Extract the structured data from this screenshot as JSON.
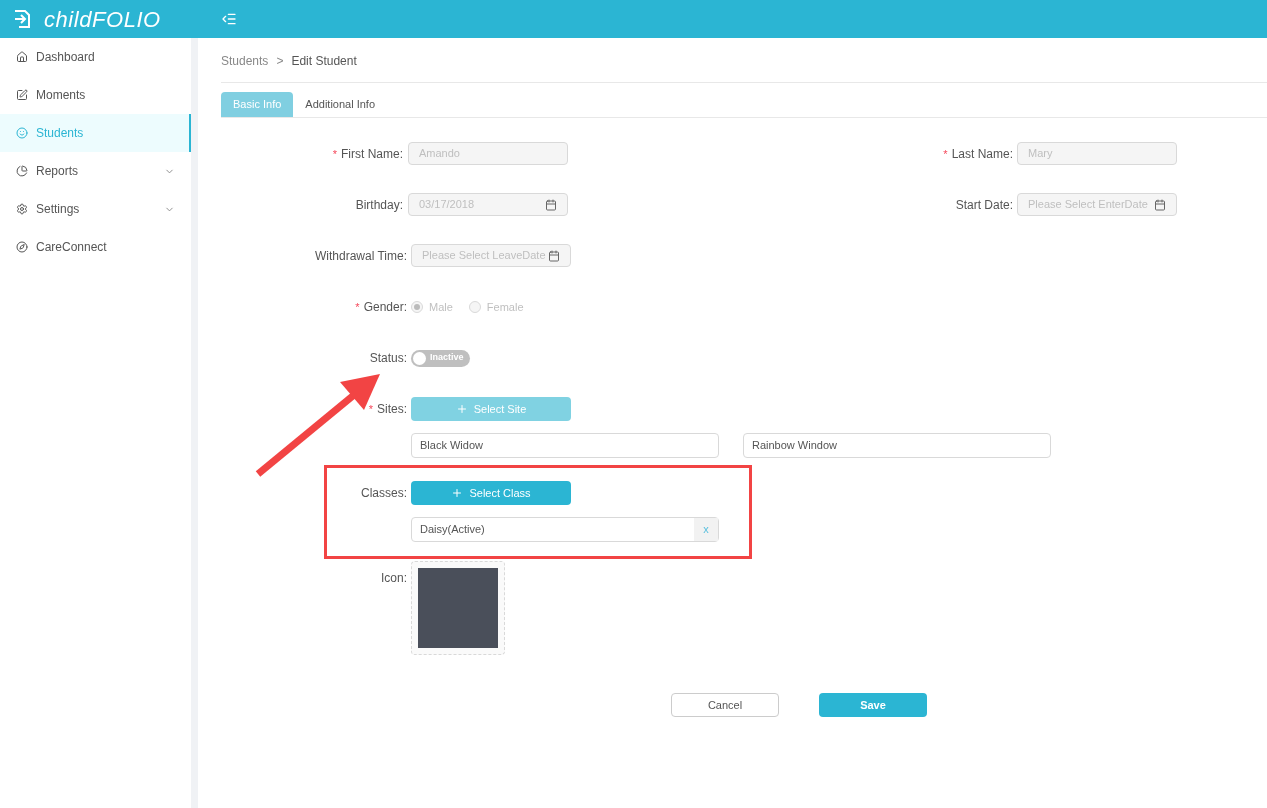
{
  "header": {
    "logo": "childFOLIO"
  },
  "sidebar": {
    "items": [
      {
        "label": "Dashboard",
        "selected": false,
        "has_submenu": false
      },
      {
        "label": "Moments",
        "selected": false,
        "has_submenu": false
      },
      {
        "label": "Students",
        "selected": true,
        "has_submenu": false
      },
      {
        "label": "Reports",
        "selected": false,
        "has_submenu": true
      },
      {
        "label": "Settings",
        "selected": false,
        "has_submenu": true
      },
      {
        "label": "CareConnect",
        "selected": false,
        "has_submenu": false
      }
    ]
  },
  "breadcrumb": [
    "Students",
    "Edit Student"
  ],
  "breadcrumb_separator": ">",
  "tabs": [
    {
      "label": "Basic Info",
      "selected": true
    },
    {
      "label": "Additional Info",
      "selected": false
    }
  ],
  "form": {
    "first_name": {
      "label": "First Name:",
      "required_mark": "*",
      "value": "Amando",
      "disabled": true
    },
    "last_name": {
      "label": "Last Name:",
      "required_mark": "*",
      "value": "Mary",
      "disabled": true
    },
    "birthday": {
      "label": "Birthday:",
      "value": "03/17/2018",
      "disabled": true
    },
    "start_date": {
      "label": "Start Date:",
      "placeholder": "Please Select EnterDate",
      "disabled": true
    },
    "withdrawal_time": {
      "label": "Withdrawal Time:",
      "placeholder": "Please Select LeaveDate",
      "disabled": true
    },
    "gender": {
      "label": "Gender:",
      "required_mark": "*",
      "disabled": true,
      "options": [
        {
          "label": "Male",
          "selected": true
        },
        {
          "label": "Female",
          "selected": false
        }
      ]
    },
    "status": {
      "label": "Status:",
      "on": false,
      "text": "Inactive"
    },
    "sites": {
      "label": "Sites:",
      "required_mark": "*",
      "button": "Select Site",
      "button_disabled": true,
      "items": [
        "Black Widow",
        "Rainbow Window"
      ]
    },
    "classes": {
      "label": "Classes:",
      "button": "Select Class",
      "button_disabled": false,
      "items": [
        {
          "label": "Daisy(Active)",
          "remove": "x"
        }
      ]
    },
    "icon": {
      "label": "Icon:"
    }
  },
  "buttons": {
    "cancel": "Cancel",
    "save": "Save"
  }
}
